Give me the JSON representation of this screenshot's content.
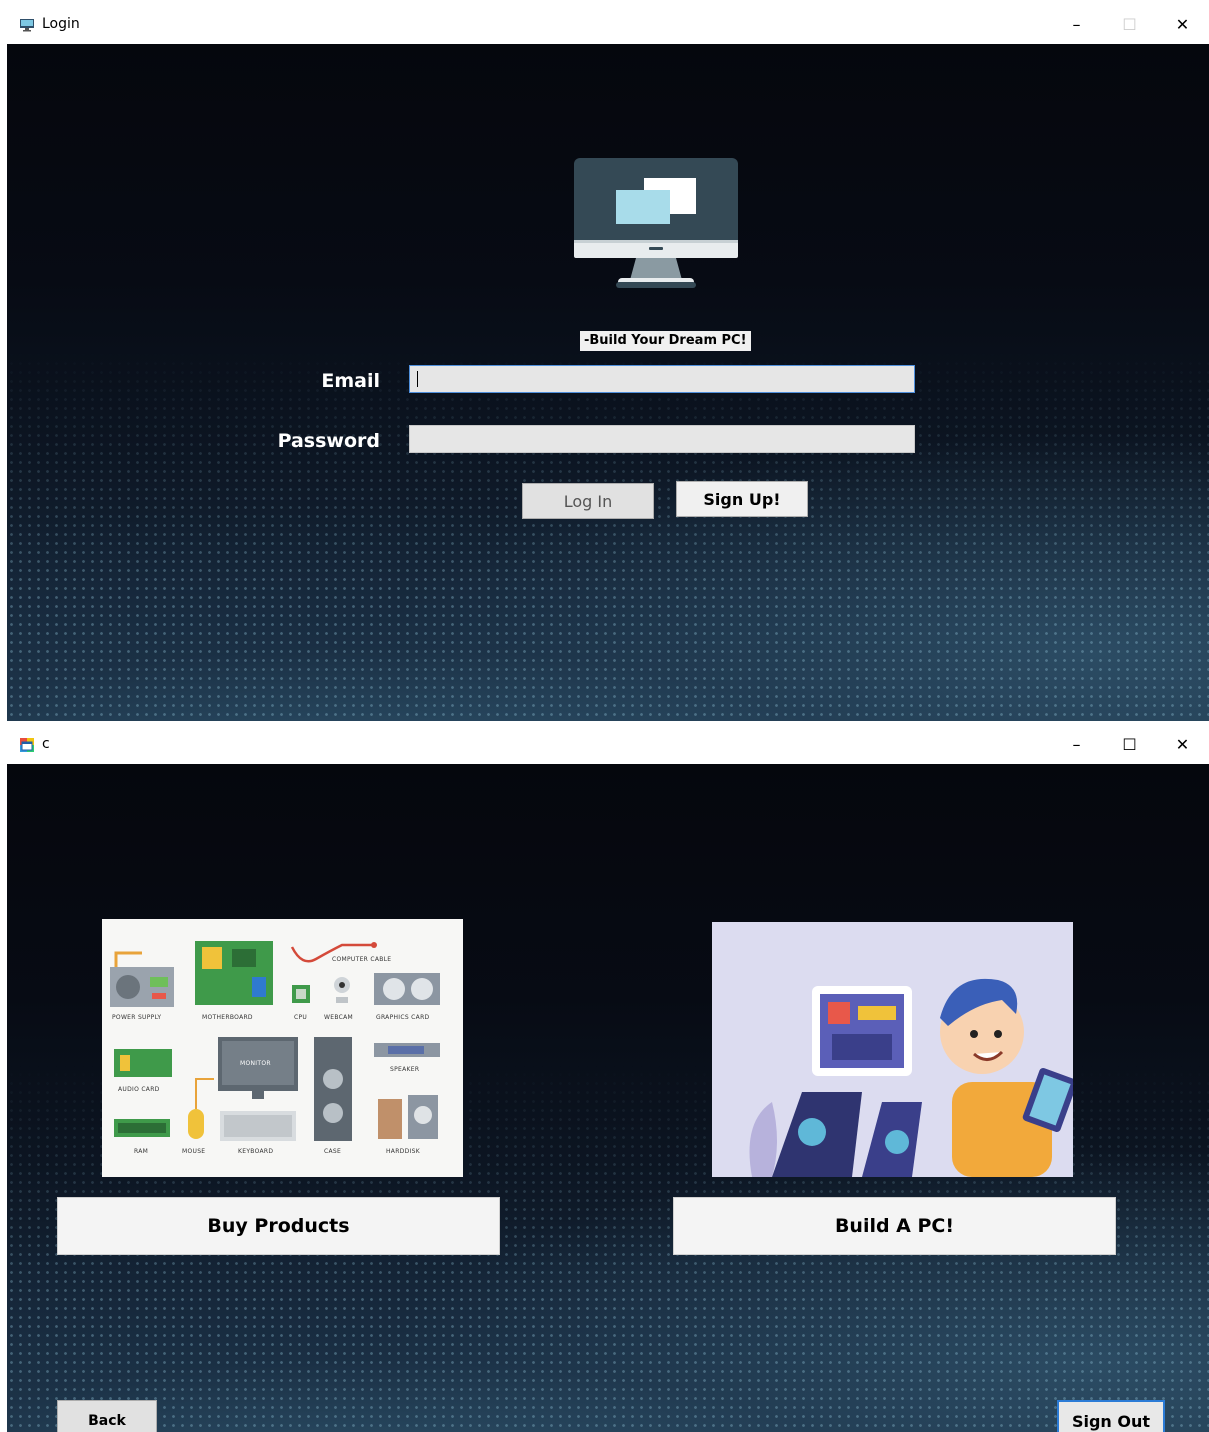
{
  "login_window": {
    "title": "Login",
    "icon": "monitor-app-icon",
    "controls": {
      "minimize": "–",
      "maximize": "☐",
      "close": "✕"
    },
    "logo_icon": "monitor-logo-icon",
    "tagline": "-Build Your Dream PC!",
    "email_label": "Email",
    "email_value": "",
    "password_label": "Password",
    "password_value": "",
    "login_label": "Log In",
    "signup_label": "Sign Up!"
  },
  "home_window": {
    "title": "c",
    "icon": "form-app-icon",
    "controls": {
      "minimize": "–",
      "maximize": "☐",
      "close": "✕"
    },
    "parts_image": {
      "icon": "pc-parts-illustration",
      "labels": [
        "COMPUTER CABLE",
        "POWER SUPPLY",
        "MOTHERBOARD",
        "CPU",
        "WEBCAM",
        "GRAPHICS CARD",
        "MONITOR",
        "SPEAKER",
        "AUDIO CARD",
        "RAM",
        "MOUSE",
        "KEYBOARD",
        "CASE",
        "HARDDISK"
      ]
    },
    "builder_image": {
      "icon": "pc-builder-illustration"
    },
    "buy_products_label": "Buy Products",
    "build_pc_label": "Build A PC!",
    "back_label": "Back",
    "signout_label": "Sign Out"
  },
  "colors": {
    "accent_blue": "#2b7bd6",
    "background_dark": "#05070d",
    "logo_dark": "#344955",
    "logo_screen": "#a8dcea"
  }
}
